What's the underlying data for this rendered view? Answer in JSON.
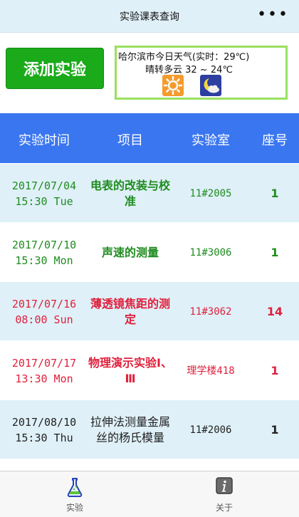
{
  "titlebar": {
    "title": "实验课表查询",
    "more_label": "•••"
  },
  "topbar": {
    "add_button": "添加实验",
    "weather_line1": "哈尔滨市今日天气(实时：29℃)",
    "weather_line2": "晴转多云 32 ~ 24℃",
    "day_icon": "sun-icon",
    "night_icon": "moon-cloud-icon"
  },
  "table": {
    "headers": [
      "实验时间",
      "项目",
      "实验室",
      "座号"
    ],
    "rows": [
      {
        "date": "2017/07/04",
        "time": "15:30 Tue",
        "item": "电表的改装与校准",
        "lab": "11#2005",
        "seat": "1",
        "status": "green"
      },
      {
        "date": "2017/07/10",
        "time": "15:30 Mon",
        "item": "声速的测量",
        "lab": "11#3006",
        "seat": "1",
        "status": "green"
      },
      {
        "date": "2017/07/16",
        "time": "08:00 Sun",
        "item": "薄透镜焦距的测定",
        "lab": "11#3062",
        "seat": "14",
        "status": "red"
      },
      {
        "date": "2017/07/17",
        "time": "13:30 Mon",
        "item": "物理演示实验Ⅰ、Ⅲ",
        "lab": "理学楼418",
        "seat": "1",
        "status": "red"
      },
      {
        "date": "2017/08/10",
        "time": "15:30 Thu",
        "item": "拉伸法测量金属丝的杨氏模量",
        "lab": "11#2006",
        "seat": "1",
        "status": "dark"
      }
    ]
  },
  "colors": {
    "green": "#1f8c1f",
    "red": "#e0203c",
    "header": "#3a76f0",
    "accent": "#1aaa1a"
  },
  "tabbar": {
    "tabs": [
      {
        "label": "实验",
        "icon": "flask-icon"
      },
      {
        "label": "关于",
        "icon": "info-icon"
      }
    ]
  }
}
